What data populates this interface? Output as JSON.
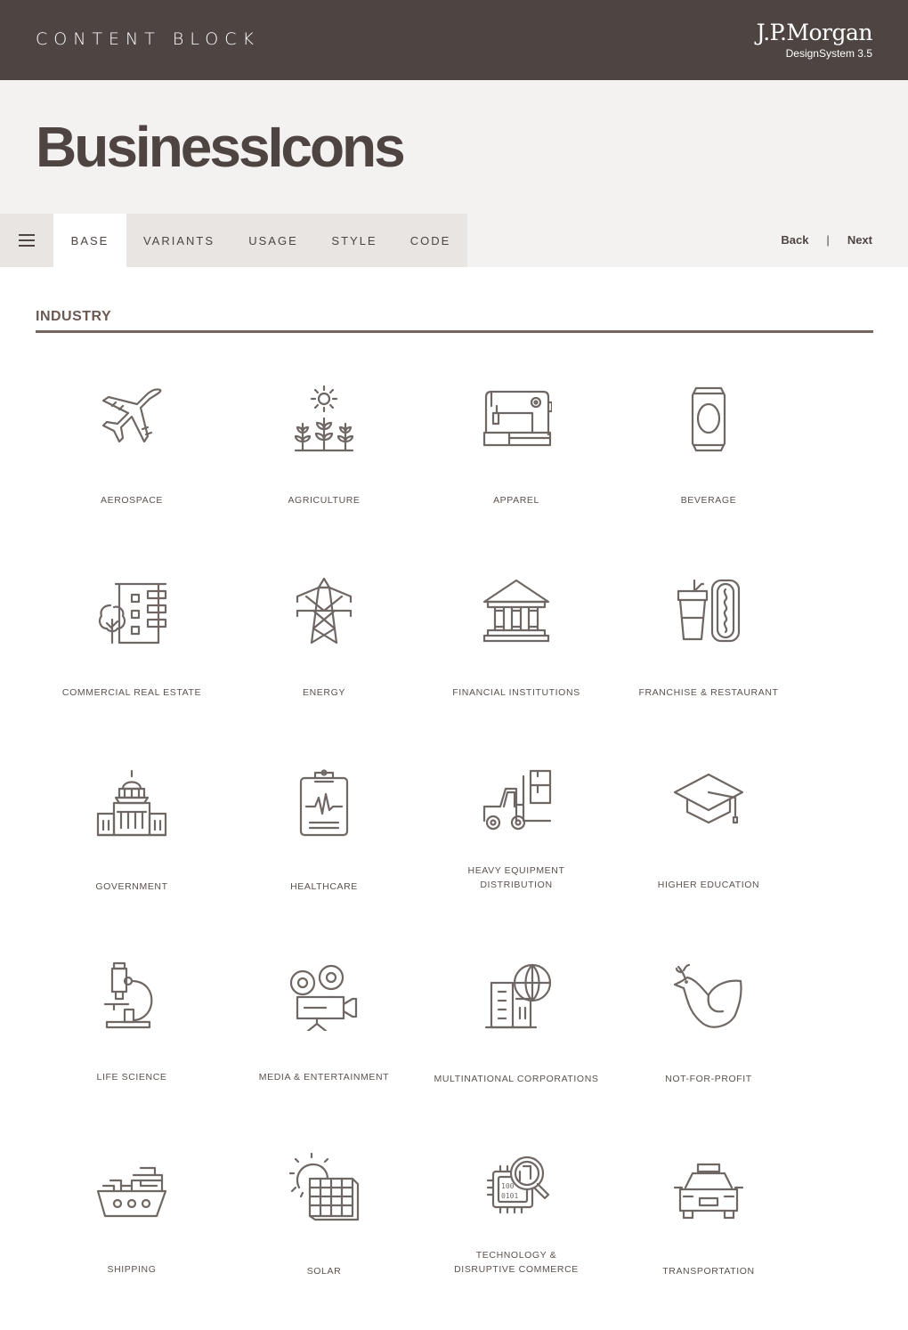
{
  "header": {
    "title": "CONTENT BLOCK",
    "brand": "J.P.Morgan",
    "brand_sub": "DesignSystem  3.5"
  },
  "hero": {
    "title": "BusinessIcons"
  },
  "tabs": [
    {
      "label": "BASE",
      "active": true
    },
    {
      "label": "VARIANTS",
      "active": false
    },
    {
      "label": "USAGE",
      "active": false
    },
    {
      "label": "STYLE",
      "active": false
    },
    {
      "label": "CODE",
      "active": false
    }
  ],
  "pager": {
    "back": "Back",
    "separator": "|",
    "next": "Next"
  },
  "section": {
    "title": "INDUSTRY"
  },
  "icons": [
    {
      "label": "AEROSPACE",
      "icon": "airplane-icon"
    },
    {
      "label": "AGRICULTURE",
      "icon": "sprout-sun-icon"
    },
    {
      "label": "APPAREL",
      "icon": "sewing-machine-icon"
    },
    {
      "label": "BEVERAGE",
      "icon": "can-icon"
    },
    {
      "label": "COMMERCIAL REAL ESTATE",
      "icon": "building-tree-icon"
    },
    {
      "label": "ENERGY",
      "icon": "power-tower-icon"
    },
    {
      "label": "FINANCIAL INSTITUTIONS",
      "icon": "bank-icon"
    },
    {
      "label": "FRANCHISE & RESTAURANT",
      "icon": "drink-hotdog-icon"
    },
    {
      "label": "GOVERNMENT",
      "icon": "capitol-icon"
    },
    {
      "label": "HEALTHCARE",
      "icon": "clipboard-pulse-icon"
    },
    {
      "label": "HEAVY EQUIPMENT\nDISTRIBUTION",
      "icon": "forklift-icon"
    },
    {
      "label": "HIGHER EDUCATION",
      "icon": "graduation-cap-icon"
    },
    {
      "label": "LIFE SCIENCE",
      "icon": "microscope-icon"
    },
    {
      "label": "MEDIA & ENTERTAINMENT",
      "icon": "film-camera-icon"
    },
    {
      "label": "MULTINATIONAL CORPORATIONS",
      "icon": "buildings-globe-icon"
    },
    {
      "label": "NOT-FOR-PROFIT",
      "icon": "dove-icon"
    },
    {
      "label": "SHIPPING",
      "icon": "cargo-ship-icon"
    },
    {
      "label": "SOLAR",
      "icon": "solar-panel-icon"
    },
    {
      "label": "TECHNOLOGY &\nDISRUPTIVE COMMERCE",
      "icon": "chip-magnifier-icon"
    },
    {
      "label": "TRANSPORTATION",
      "icon": "taxi-icon"
    }
  ],
  "chip_text": [
    "100",
    "0101"
  ]
}
